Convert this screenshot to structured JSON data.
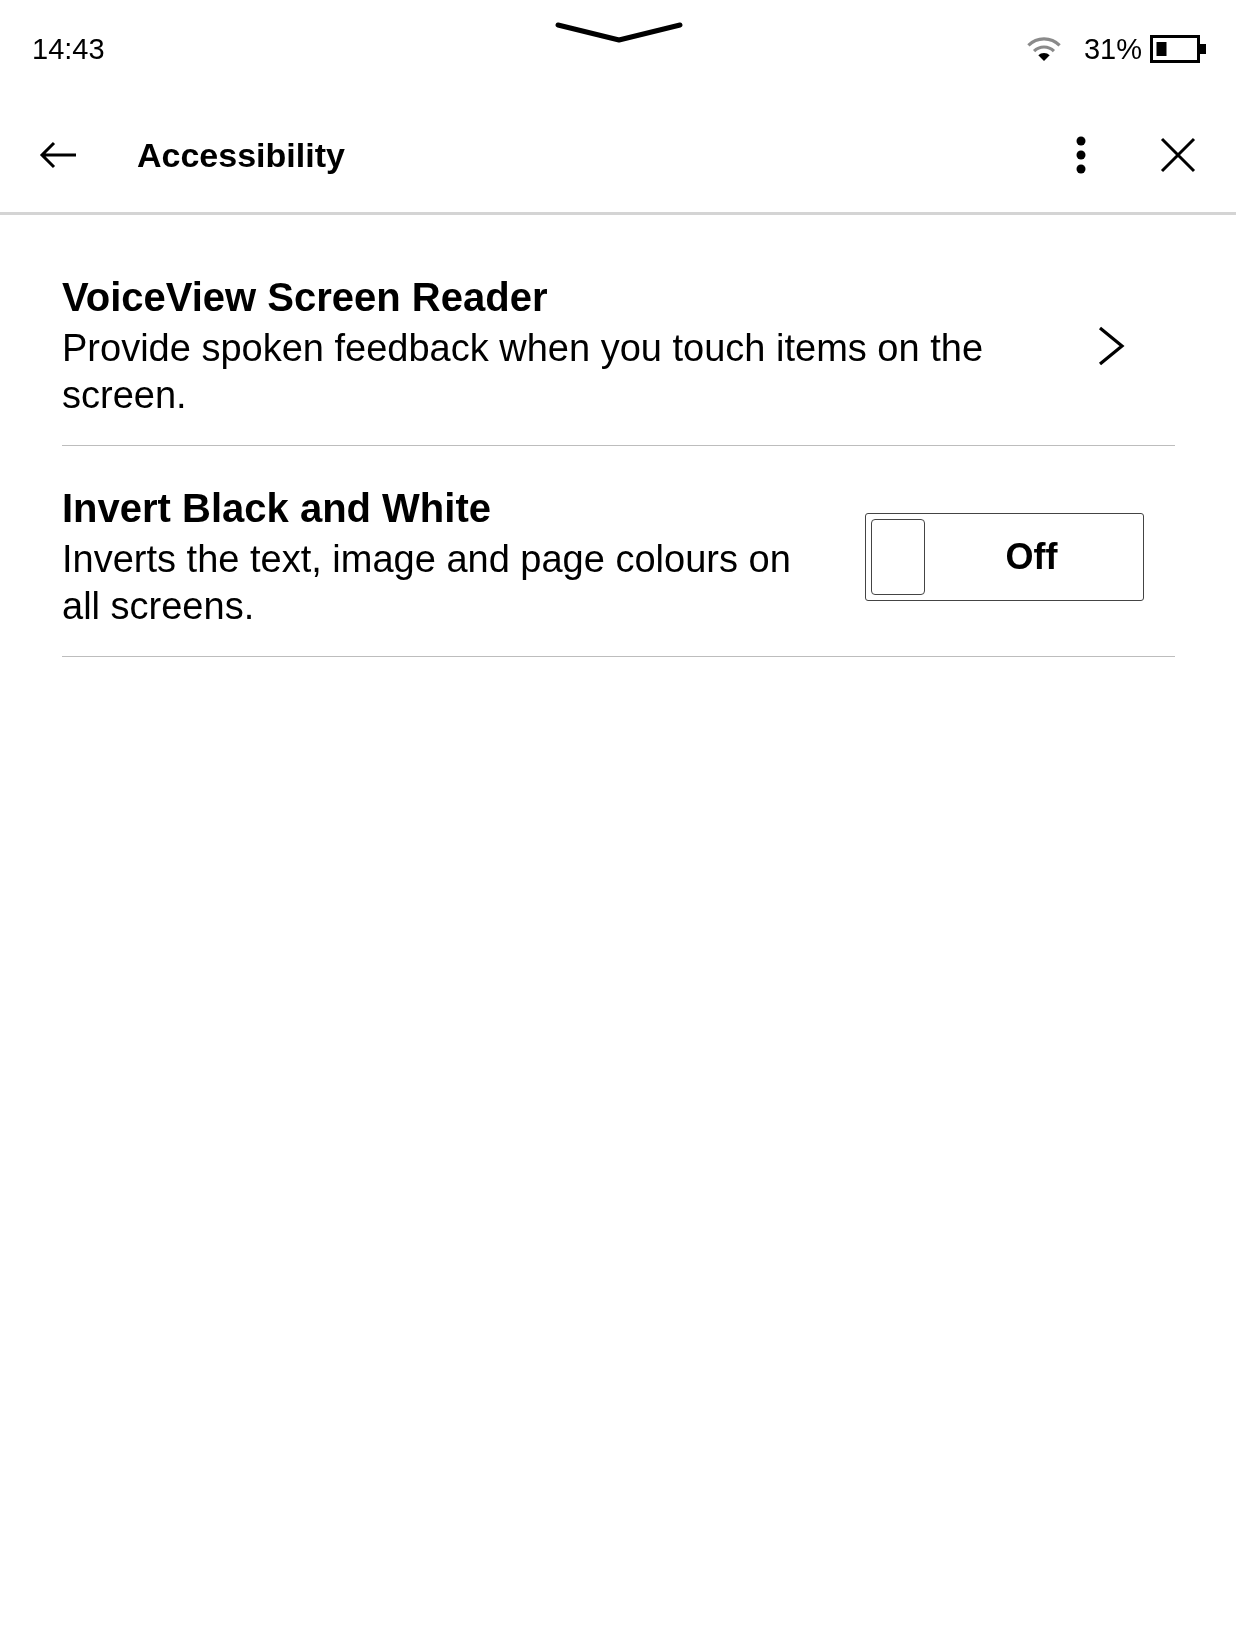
{
  "status_bar": {
    "time": "14:43",
    "battery_text": "31%"
  },
  "header": {
    "title": "Accessibility"
  },
  "settings": [
    {
      "kind": "link",
      "title": "VoiceView Screen Reader",
      "description": "Provide spoken feedback when you touch items on the screen."
    },
    {
      "kind": "toggle",
      "title": "Invert Black and White",
      "description": "Inverts the text, image and page colours on all screens.",
      "on": false,
      "state_label": "Off"
    }
  ]
}
